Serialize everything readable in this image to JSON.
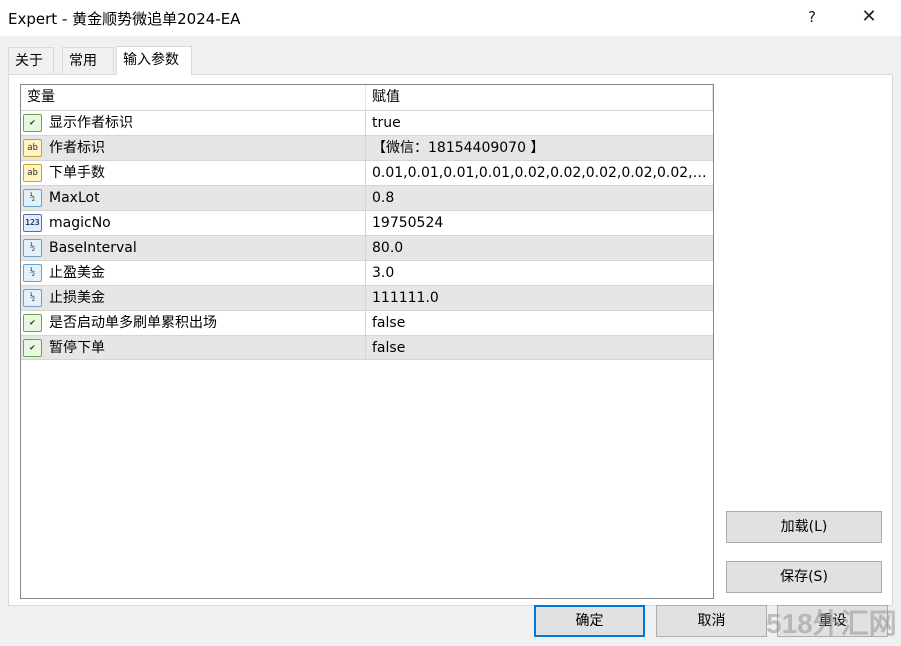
{
  "window": {
    "title": "Expert - 黄金顺势微追单2024-EA",
    "help_label": "?",
    "close_label": "✕"
  },
  "tabs": [
    {
      "label": "关于"
    },
    {
      "label": "常用"
    },
    {
      "label": "输入参数"
    }
  ],
  "grid": {
    "col_variable": "变量",
    "col_value": "赋值",
    "rows": [
      {
        "icon": "bool-icon",
        "icon_text": "⁄",
        "name": "显示作者标识",
        "value": "true"
      },
      {
        "icon": "string-icon",
        "icon_text": "ab",
        "name": "作者标识",
        "value": "【微信：18154409070 】"
      },
      {
        "icon": "string-icon",
        "icon_text": "ab",
        "name": "下单手数",
        "value": "0.01,0.01,0.01,0.01,0.02,0.02,0.02,0.02,0.02,0..."
      },
      {
        "icon": "double-icon",
        "icon_text": "½",
        "name": "MaxLot",
        "value": "0.8"
      },
      {
        "icon": "int-icon",
        "icon_text": "123",
        "name": "magicNo",
        "value": "19750524"
      },
      {
        "icon": "double-icon",
        "icon_text": "½",
        "name": "BaseInterval",
        "value": "80.0"
      },
      {
        "icon": "double-icon",
        "icon_text": "½",
        "name": "止盈美金",
        "value": "3.0"
      },
      {
        "icon": "double-icon",
        "icon_text": "½",
        "name": "止损美金",
        "value": "111111.0"
      },
      {
        "icon": "bool-icon",
        "icon_text": "⁄",
        "name": "是否启动单多刷单累积出场",
        "value": "false"
      },
      {
        "icon": "bool-icon",
        "icon_text": "⁄",
        "name": "暂停下单",
        "value": "false"
      }
    ]
  },
  "buttons": {
    "load": "加载(L)",
    "save": "保存(S)",
    "ok": "确定",
    "cancel": "取消",
    "reset": "重设"
  },
  "watermark": "518外汇网"
}
